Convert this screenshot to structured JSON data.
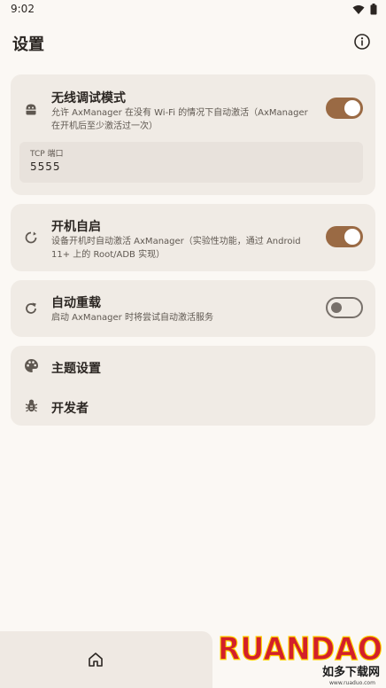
{
  "status_bar": {
    "time": "9:02"
  },
  "app_bar": {
    "title": "设置"
  },
  "wireless": {
    "title": "无线调试模式",
    "description": "允许 AxManager 在没有 Wi-Fi 的情况下自动激活（AxManager 在开机后至少激活过一次）",
    "enabled": true,
    "port_label": "TCP 端口",
    "port_value": "5555"
  },
  "boot": {
    "title": "开机自启",
    "description": "设备开机时自动激活 AxManager（实验性功能，通过 Android 11+ 上的 Root/ADB 实现）",
    "enabled": true
  },
  "reload": {
    "title": "自动重载",
    "description": "启动 AxManager 时将尝试自动激活服务",
    "enabled": false
  },
  "menu": {
    "theme_label": "主题设置",
    "developer_label": "开发者"
  },
  "watermark": {
    "brand": "RUANDAO",
    "tagline": "如多下载网",
    "url": "www.ruaduo.com"
  },
  "colors": {
    "accent": "#9a6a44",
    "card": "#f0ebe5",
    "background": "#fbf8f4"
  }
}
